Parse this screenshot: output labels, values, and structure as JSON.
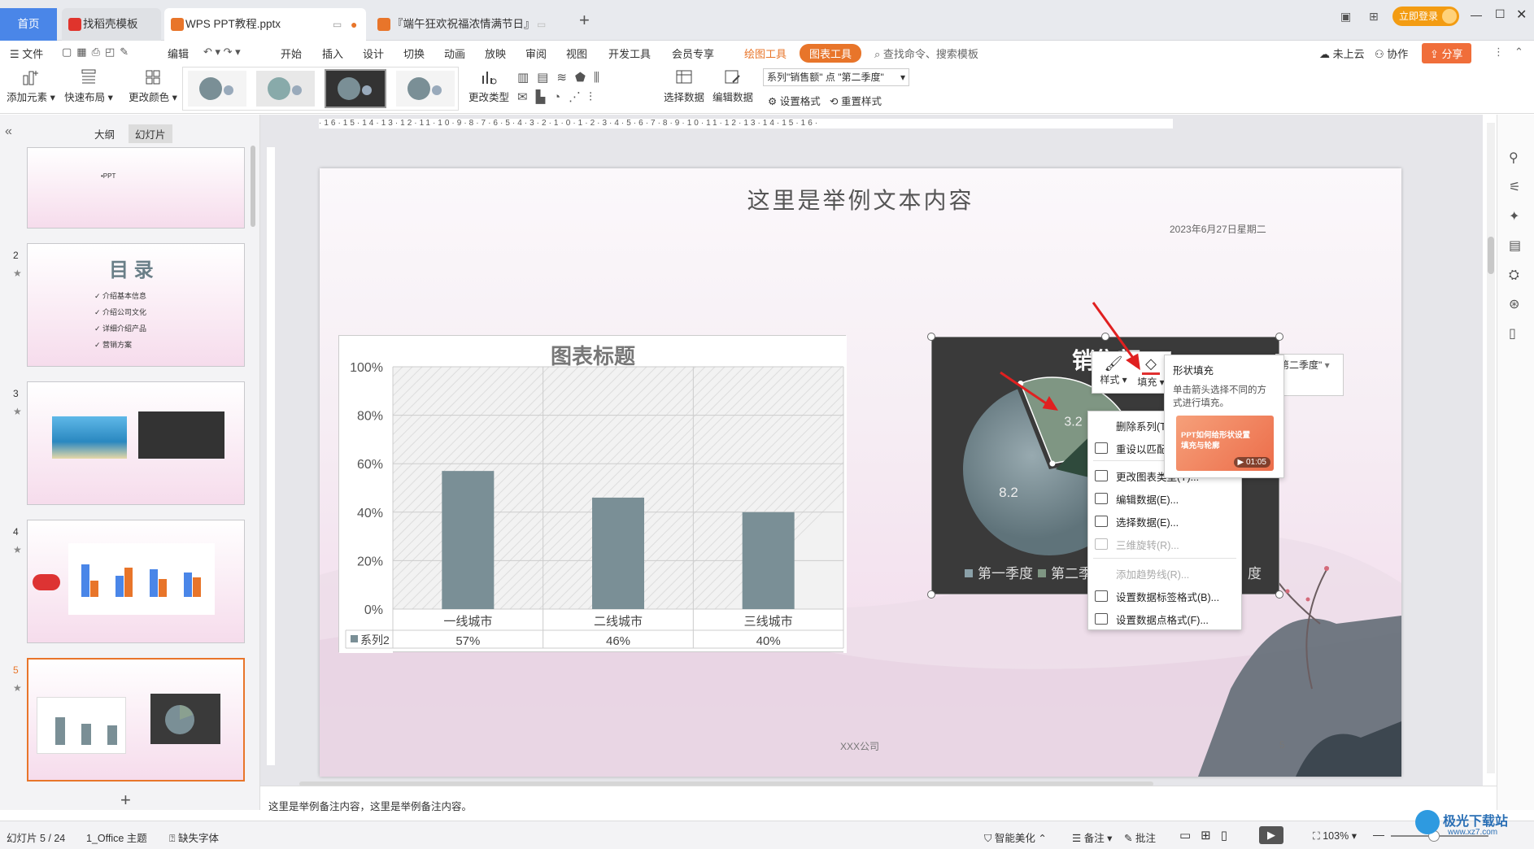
{
  "tabs": {
    "home": "首页",
    "t1": "找稻壳模板",
    "t2": "WPS PPT教程.pptx",
    "t3": "『端午狂欢祝福浓情满节日』",
    "new": "+"
  },
  "titlebar": {
    "login": "立即登录"
  },
  "menu": {
    "file": "文件",
    "edit": "编辑",
    "start": "开始",
    "insert": "插入",
    "design": "设计",
    "switch": "切换",
    "anim": "动画",
    "show": "放映",
    "review": "审阅",
    "view": "视图",
    "dev": "开发工具",
    "member": "会员专享",
    "draw": "绘图工具",
    "chart_tool": "图表工具",
    "search": "查找命令、搜索模板",
    "cloud": "未上云",
    "collab": "协作",
    "share": "分享"
  },
  "toolbar": {
    "add_elem": "添加元素",
    "quick_layout": "快速布局",
    "change_color": "更改颜色",
    "change_type": "更改类型",
    "select_data": "选择数据",
    "edit_data": "编辑数据",
    "series_dropdown": "系列\"销售额\" 点 \"第二季度\"",
    "set_format": "设置格式",
    "reset_style": "重置样式"
  },
  "leftpanel": {
    "outline": "大纲",
    "slides": "幻灯片",
    "slide1_text": "•PPT",
    "slide2": {
      "num": "2",
      "title": "目 录",
      "items": [
        "介绍基本信息",
        "介绍公司文化",
        "详细介绍产品",
        "营销方案"
      ]
    },
    "slide3": {
      "num": "3"
    },
    "slide4": {
      "num": "4"
    },
    "slide5": {
      "num": "5"
    },
    "add": "+"
  },
  "slide": {
    "title": "这里是举例文本内容",
    "date": "2023年6月27日星期二",
    "company": "XXX公司",
    "page": "5",
    "series_dropdown": "第二季度\""
  },
  "chart_data": [
    {
      "type": "bar",
      "title": "图表标题",
      "categories": [
        "一线城市",
        "二线城市",
        "三线城市"
      ],
      "series": [
        {
          "name": "系列2",
          "values": [
            0.57,
            0.46,
            0.4
          ]
        }
      ],
      "data_labels": [
        "57%",
        "46%",
        "40%"
      ],
      "yticks": [
        "100%",
        "80%",
        "60%",
        "40%",
        "20%",
        "0%"
      ],
      "ylim": [
        0,
        1
      ],
      "color": "#7a8f96"
    },
    {
      "type": "pie",
      "title": "销售额",
      "labels": [
        "第一季度",
        "第二季度"
      ],
      "values": [
        8.2,
        3.2
      ],
      "visible_labels": [
        "8.2",
        "3.2",
        "3"
      ],
      "legend_suffix": "度"
    }
  ],
  "float_toolbar": {
    "style": "样式",
    "fill": "填充"
  },
  "tooltip": {
    "title": "形状填充",
    "desc": "单击箭头选择不同的方式进行填充。",
    "video_title": "PPT如何给形状设置填充与轮廓",
    "video_time": "01:05"
  },
  "context_menu": [
    {
      "label": "删除系列(T)",
      "disabled": false
    },
    {
      "label": "重设以匹配",
      "disabled": false
    },
    {
      "label": "更改图表类型(Y)...",
      "disabled": false
    },
    {
      "label": "编辑数据(E)...",
      "disabled": false
    },
    {
      "label": "选择数据(E)...",
      "disabled": false
    },
    {
      "label": "三维旋转(R)...",
      "disabled": true
    },
    {
      "label": "添加趋势线(R)...",
      "disabled": true
    },
    {
      "label": "设置数据标签格式(B)...",
      "disabled": false
    },
    {
      "label": "设置数据点格式(F)...",
      "disabled": false
    }
  ],
  "notes": "这里是举例备注内容，这里是举例备注内容。",
  "status": {
    "slide_count": "幻灯片 5 / 24",
    "theme": "1_Office 主题",
    "missing_font": "缺失字体",
    "beautify": "智能美化",
    "notes": "备注",
    "comment": "批注",
    "zoom": "103%"
  },
  "watermark": "极光下载站",
  "watermark_url": "www.xz7.com",
  "colors": {
    "accent": "#4a86e8",
    "orange": "#e8752a",
    "bar": "#7a8f96",
    "chart_bg": "#3a3a3a"
  }
}
